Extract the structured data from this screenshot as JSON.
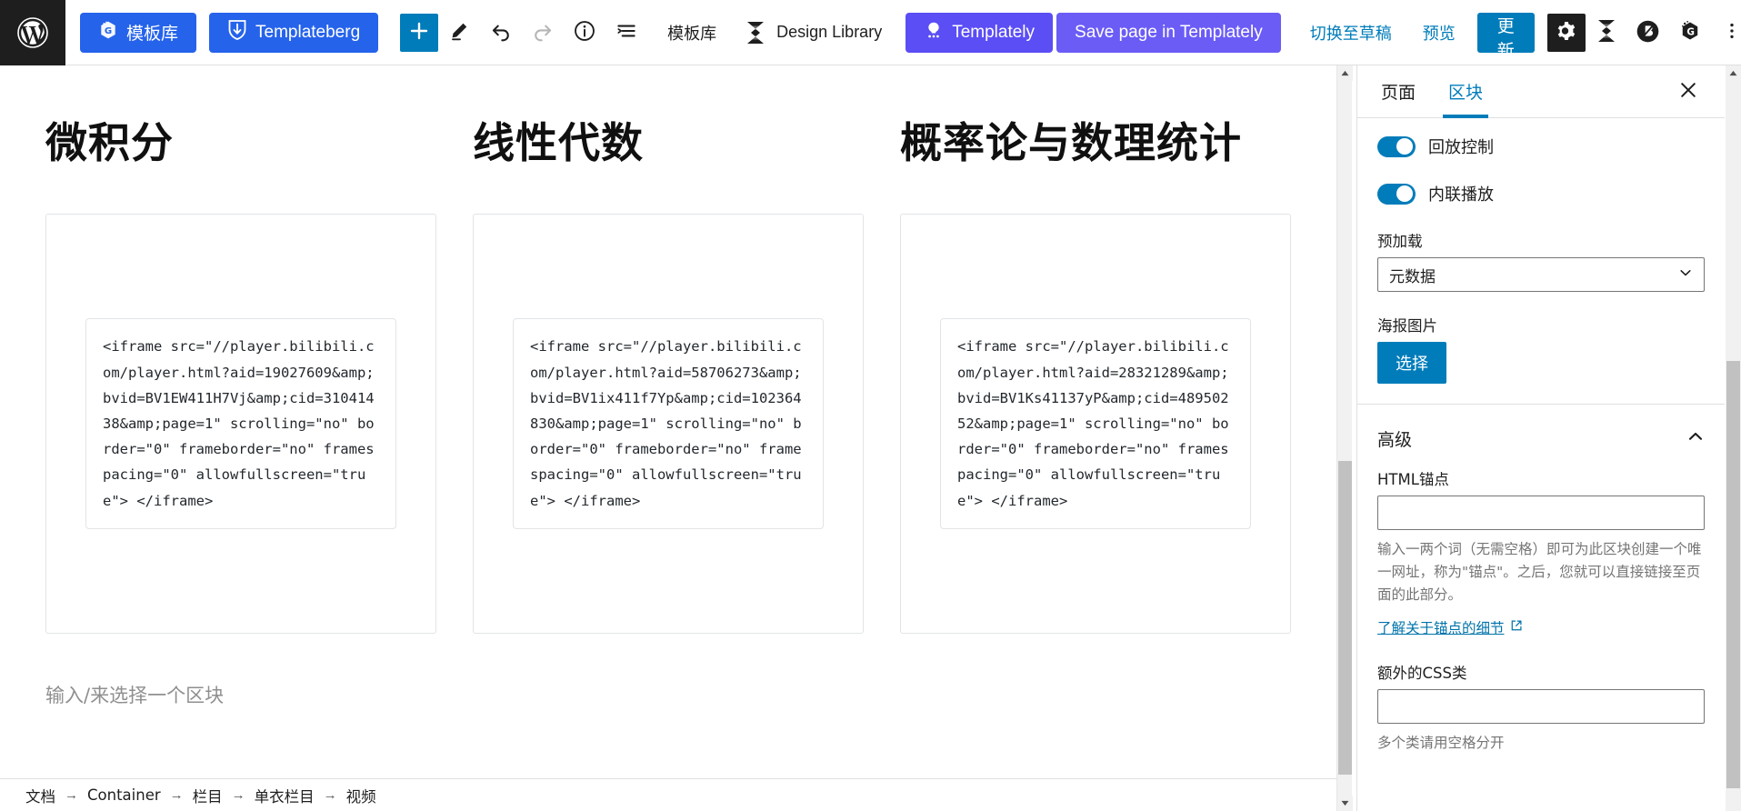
{
  "toolbar": {
    "wp_logo": "wordpress-logo",
    "buttons": [
      {
        "name": "gutenkit-template-library",
        "label": "模板库",
        "icon": "gutenkit-icon",
        "style": "blue"
      },
      {
        "name": "templateberg",
        "label": "Templateberg",
        "icon": "templateberg-icon",
        "style": "blue"
      }
    ],
    "icons": [
      {
        "name": "add-block",
        "glyph": "+",
        "title": "添加区块"
      },
      {
        "name": "edit-tool",
        "glyph": "pencil",
        "title": "工具"
      },
      {
        "name": "undo",
        "glyph": "undo",
        "title": "撤销"
      },
      {
        "name": "redo",
        "glyph": "redo",
        "title": "重做",
        "disabled": true
      },
      {
        "name": "details",
        "glyph": "info",
        "title": "详情"
      },
      {
        "name": "list-view",
        "glyph": "list-view",
        "title": "列表视图"
      }
    ],
    "center_text": "模板库",
    "design_library_label": "Design Library",
    "templately_label": "Templately",
    "save_templately_label": "Save page in Templately",
    "switch_to_draft": "切换至草稿",
    "preview": "预览",
    "update": "更新",
    "right_icons": [
      {
        "name": "settings-gear-icon",
        "glyph": "gear"
      },
      {
        "name": "design-library-icon",
        "glyph": "hourglass-s"
      },
      {
        "name": "betterdocs-icon",
        "glyph": "b-circle"
      },
      {
        "name": "gutenkit-icon",
        "glyph": "g-hex"
      },
      {
        "name": "options-more-icon",
        "glyph": "kebab"
      }
    ],
    "colors": {
      "blue_button": "#2563eb",
      "purple_button": "#5b4ef5",
      "wp_blue": "#007cba",
      "dark": "#1e1e1e"
    }
  },
  "canvas": {
    "columns": [
      {
        "heading": "微积分",
        "code": "<iframe src=\"//player.bilibili.com/player.html?aid=19027609&amp;bvid=BV1EW411H7Vj&amp;cid=31041438&amp;page=1\" scrolling=\"no\" border=\"0\" frameborder=\"no\" framespacing=\"0\" allowfullscreen=\"true\"> </iframe>"
      },
      {
        "heading": "线性代数",
        "code": "<iframe src=\"//player.bilibili.com/player.html?aid=58706273&amp;bvid=BV1ix411f7Yp&amp;cid=102364830&amp;page=1\" scrolling=\"no\" border=\"0\" frameborder=\"no\" framespacing=\"0\" allowfullscreen=\"true\"> </iframe>"
      },
      {
        "heading": "概率论与数理统计",
        "code": "<iframe src=\"//player.bilibili.com/player.html?aid=28321289&amp;bvid=BV1Ks41137yP&amp;cid=48950252&amp;page=1\" scrolling=\"no\" border=\"0\" frameborder=\"no\" framespacing=\"0\" allowfullscreen=\"true\"> </iframe>"
      }
    ],
    "appender_placeholder": "输入/来选择一个区块"
  },
  "breadcrumb": {
    "items": [
      "文档",
      "Container",
      "栏目",
      "单衣栏目",
      "视频"
    ],
    "separator": "→"
  },
  "sidebar": {
    "tabs": [
      {
        "name": "tab-page",
        "label": "页面",
        "active": false
      },
      {
        "name": "tab-block",
        "label": "区块",
        "active": true
      }
    ],
    "close_label": "关闭设置",
    "settings": {
      "toggles": [
        {
          "name": "playback-controls",
          "label": "回放控制",
          "on": true
        },
        {
          "name": "inline-playback",
          "label": "内联播放",
          "on": true
        }
      ],
      "preload_label": "预加载",
      "preload_value": "元数据",
      "poster_label": "海报图片",
      "poster_button": "选择"
    },
    "advanced": {
      "title": "高级",
      "expanded": true,
      "anchor_label": "HTML锚点",
      "anchor_value": "",
      "anchor_help": "输入一两个词（无需空格）即可为此区块创建一个唯一网址，称为\"锚点\"。之后，您就可以直接链接至页面的此部分。",
      "anchor_link": "了解关于锚点的细节",
      "css_label": "额外的CSS类",
      "css_value": "",
      "css_help": "多个类请用空格分开"
    }
  }
}
